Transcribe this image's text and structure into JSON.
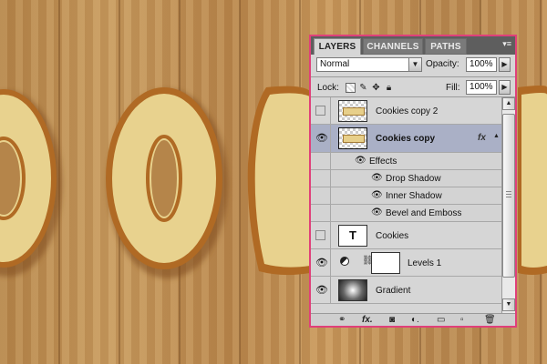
{
  "panel": {
    "tabs": [
      {
        "label": "LAYERS",
        "active": true
      },
      {
        "label": "CHANNELS",
        "active": false
      },
      {
        "label": "PATHS",
        "active": false
      }
    ],
    "menu_icon": "▾≡",
    "blend_mode": "Normal",
    "opacity_label": "Opacity:",
    "opacity_value": "100%",
    "lock_label": "Lock:",
    "fill_label": "Fill:",
    "fill_value": "100%",
    "layers": [
      {
        "name": "Cookies copy 2",
        "visible": false,
        "thumb": "text-raster"
      },
      {
        "name": "Cookies copy",
        "visible": true,
        "selected": true,
        "thumb": "text-raster",
        "fx": "fx"
      },
      {
        "name": "Cookies",
        "visible": false,
        "thumb": "type"
      },
      {
        "name": "Levels 1",
        "visible": true,
        "thumb": "adjustment"
      },
      {
        "name": "Gradient",
        "visible": true,
        "thumb": "gradient"
      }
    ],
    "effects_label": "Effects",
    "effects": [
      "Drop Shadow",
      "Inner Shadow",
      "Bevel and Emboss"
    ],
    "type_glyph": "T"
  },
  "colors": {
    "highlight_border": "#e0407a",
    "selected_row": "#aab0c6",
    "panel_bg": "#d6d6d6",
    "cookie_fill": "#e8d28e",
    "cookie_edge": "#b06a24"
  }
}
